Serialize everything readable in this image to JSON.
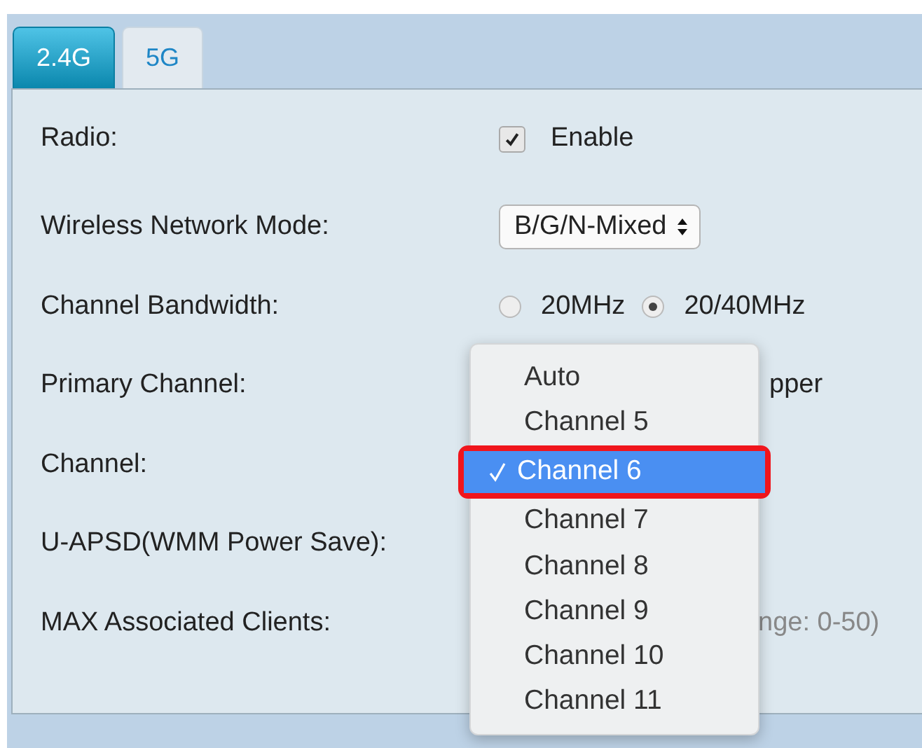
{
  "tabs": [
    {
      "label": "2.4G",
      "selected": true
    },
    {
      "label": "5G",
      "selected": false
    }
  ],
  "rows": [
    {
      "kind": "checkbox",
      "label": "Radio:",
      "checked": true,
      "text": "Enable"
    },
    {
      "kind": "select",
      "label": "Wireless Network Mode:",
      "value": "B/G/N-Mixed"
    },
    {
      "kind": "radio",
      "label": "Channel Bandwidth:",
      "options": [
        {
          "label": "20MHz",
          "selected": false
        },
        {
          "label": "20/40MHz",
          "selected": true
        }
      ]
    },
    {
      "kind": "partial",
      "label": "Primary Channel:",
      "text": "pper"
    },
    {
      "kind": "covered",
      "label": "Channel:"
    },
    {
      "kind": "covered",
      "label": "U-APSD(WMM Power Save):"
    },
    {
      "kind": "partial",
      "label": "MAX Associated Clients:",
      "text": "nge: 0-50)"
    }
  ],
  "dropdown": {
    "options": [
      {
        "label": "Auto",
        "selected": false
      },
      {
        "label": "Channel 5",
        "selected": false
      },
      {
        "label": "Channel 6",
        "selected": true
      },
      {
        "label": "Channel 7",
        "selected": false
      },
      {
        "label": "Channel 8",
        "selected": false
      },
      {
        "label": "Channel 9",
        "selected": false
      },
      {
        "label": "Channel 10",
        "selected": false
      },
      {
        "label": "Channel 11",
        "selected": false
      }
    ]
  }
}
